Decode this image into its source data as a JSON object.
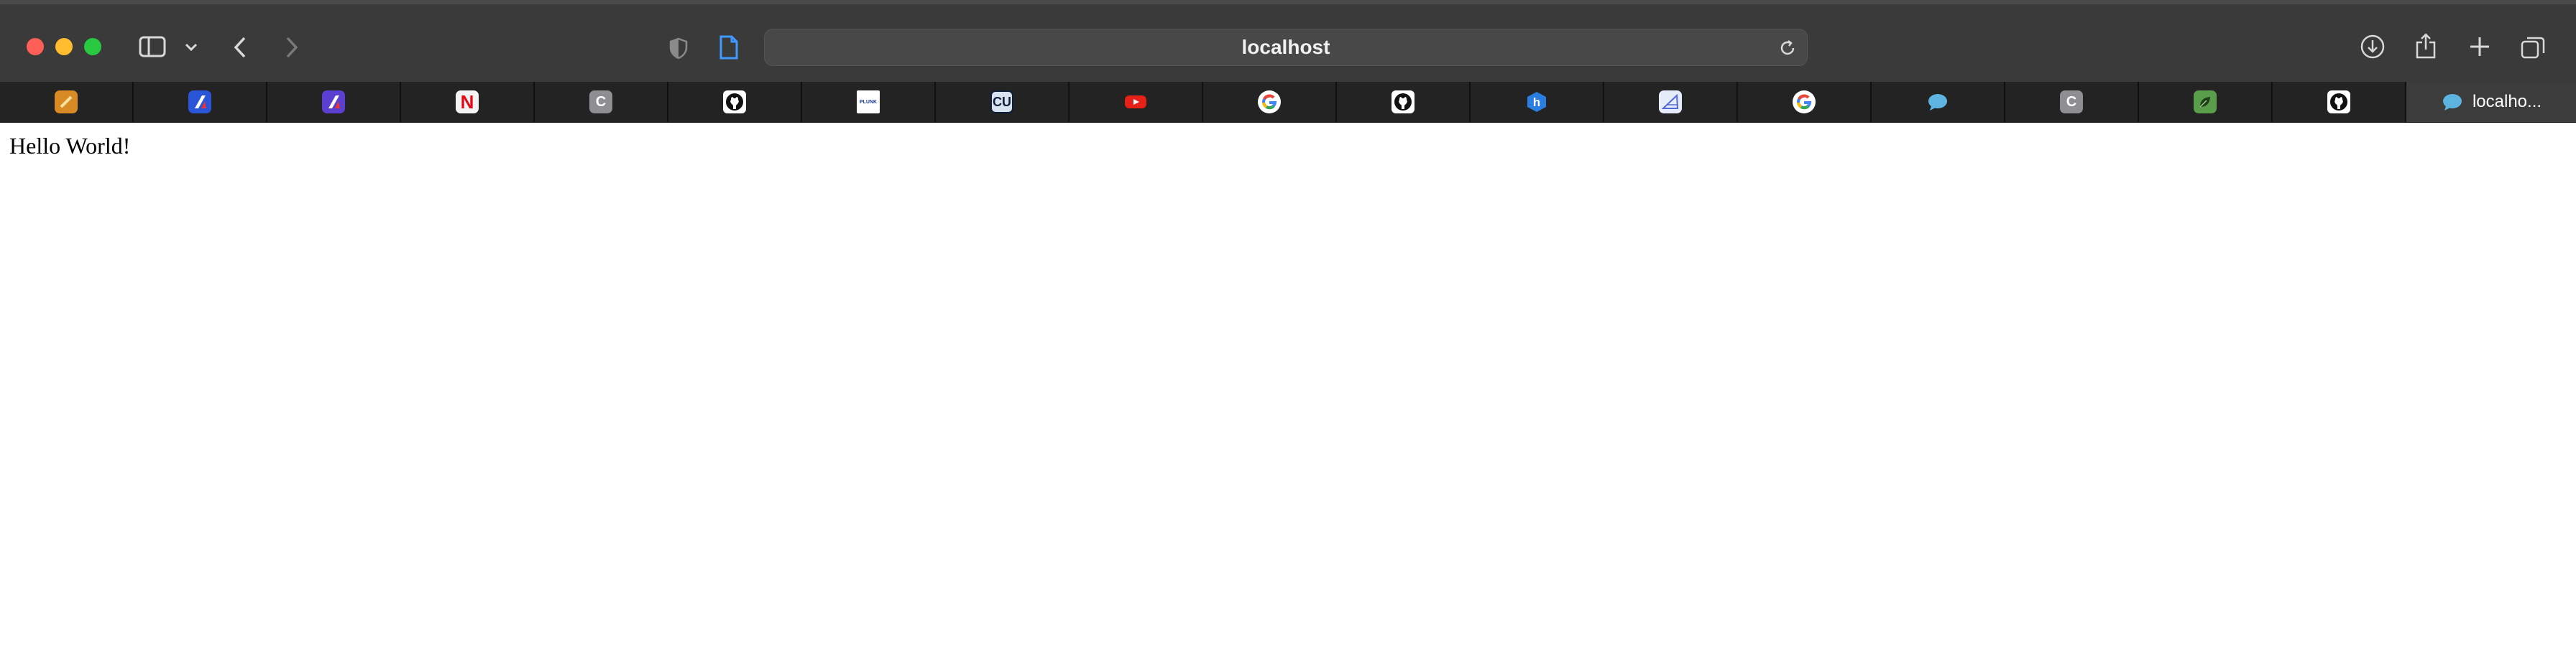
{
  "browser": {
    "address_text": "localhost",
    "active_tab_title": "localho..."
  },
  "toolbar_icons": [
    "sidebar-icon",
    "chevron-down-icon",
    "back-icon",
    "forward-icon",
    "shield-icon",
    "page-icon",
    "reload-icon",
    "download-icon",
    "share-icon",
    "plus-icon",
    "tabs-overview-icon"
  ],
  "favorites": [
    {
      "icon": "pencil-orange-icon"
    },
    {
      "icon": "blue-slash-icon"
    },
    {
      "icon": "purple-slash-icon"
    },
    {
      "icon": "netflix-icon",
      "glyph": "N"
    },
    {
      "icon": "gray-c-icon",
      "glyph": "C"
    },
    {
      "icon": "github-icon"
    },
    {
      "icon": "plunk-icon",
      "glyph": "PLUNK"
    },
    {
      "icon": "cu-icon",
      "glyph": "CU"
    },
    {
      "icon": "youtube-icon"
    },
    {
      "icon": "google-icon"
    },
    {
      "icon": "github-icon"
    },
    {
      "icon": "hexagon-h-icon",
      "glyph": "h"
    },
    {
      "icon": "ruler-icon"
    },
    {
      "icon": "google-icon"
    },
    {
      "icon": "blue-bubble-icon"
    },
    {
      "icon": "gray-c-icon",
      "glyph": "C"
    },
    {
      "icon": "green-leaf-icon"
    },
    {
      "icon": "github-icon"
    }
  ],
  "page": {
    "text": "Hello World!"
  },
  "colors": {
    "toolbar": "#3a3a3a",
    "tabstrip": "#232323",
    "active_tab": "#3c3c3c",
    "traffic_red": "#fe5f57",
    "traffic_yellow": "#febc2e",
    "traffic_green": "#28c840"
  }
}
